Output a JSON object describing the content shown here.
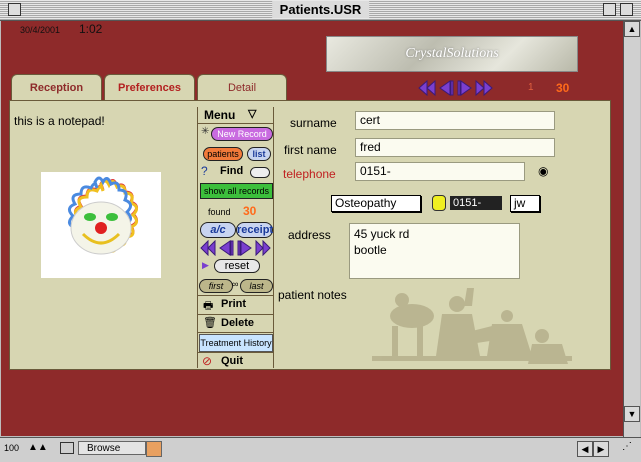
{
  "window": {
    "title": "Patients.USR"
  },
  "header": {
    "date": "30/4/2001",
    "time": "1:02",
    "logo_text": "CrystalSolutions"
  },
  "tabs": [
    {
      "label": "Reception"
    },
    {
      "label": "Preferences"
    },
    {
      "label": "Detail"
    }
  ],
  "navigation": {
    "current_record": "1",
    "total_records": "30"
  },
  "notepad": {
    "text": "this is a notepad!"
  },
  "menu": {
    "title": "Menu",
    "new_record": "New Record",
    "patients": "patients",
    "list": "list",
    "find": "Find",
    "show_all": "show all records",
    "found_label": "found",
    "found_count": "30",
    "ac": "a/c",
    "receipt": "receipt",
    "reset": "reset",
    "first": "first",
    "last": "last",
    "print": "Print",
    "delete": "Delete",
    "treatment_history": "Treatment History",
    "quit": "Quit"
  },
  "form": {
    "surname_label": "surname",
    "surname_value": "cert",
    "firstname_label": "first name",
    "firstname_value": "fred",
    "telephone_label": "telephone",
    "telephone_value": "0151-",
    "treatment_type": "Osteopathy",
    "phone_short": "0151-",
    "initials": "jw",
    "address_label": "address",
    "address_line1": "45 yuck rd",
    "address_line2": "bootle",
    "notes_label": "patient notes"
  },
  "statusbar": {
    "zoom": "100",
    "mode": "Browse"
  },
  "colors": {
    "app_bg": "#8e2a2a",
    "panel_bg": "#d7d6b2",
    "nav_arrow": "#7a3fcf",
    "count": "#ff6a1a"
  }
}
